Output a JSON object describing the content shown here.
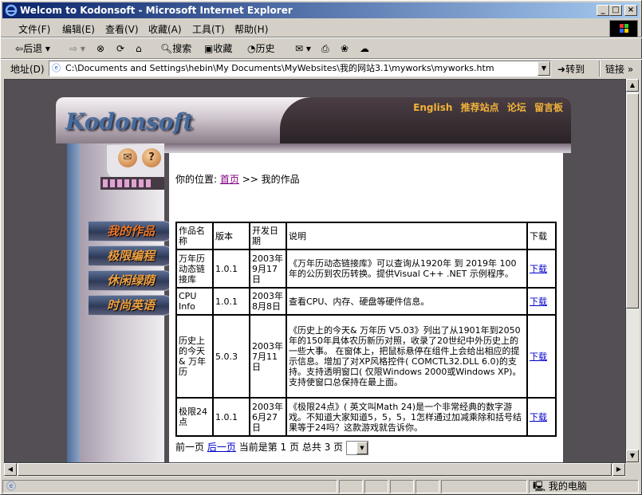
{
  "window": {
    "title": "Welcom to Kodonsoft - Microsoft Internet Explorer",
    "min": "_",
    "max": "□",
    "close": "×"
  },
  "menu": {
    "file": "文件(F)",
    "edit": "编辑(E)",
    "view": "查看(V)",
    "favorites": "收藏(A)",
    "tools": "工具(T)",
    "help": "帮助(H)"
  },
  "toolbar": {
    "back": "后退",
    "search": "搜索",
    "favorites": "收藏",
    "history": "历史"
  },
  "address": {
    "label": "地址(D)",
    "url": "C:\\Documents and Settings\\hebin\\My Documents\\MyWebsites\\我的网站3.1\\myworks\\myworks.htm",
    "go": "转到",
    "links": "链接"
  },
  "site": {
    "logo": "Kodonsoft",
    "toplinks": [
      "English",
      "推荐站点",
      "论坛",
      "留言板"
    ],
    "nav": [
      "我的作品",
      "极限编程",
      "休闲绿荫",
      "时尚英语"
    ]
  },
  "breadcrumb": {
    "prefix": "你的位置:",
    "home": "首页",
    "sep": ">>",
    "current": "我的作品"
  },
  "table": {
    "headers": [
      "作品名称",
      "版本",
      "开发日期",
      "说明",
      "下载"
    ],
    "rows": [
      {
        "name": "万年历动态链接库",
        "version": "1.0.1",
        "date": "2003年9月17日",
        "desc": "《万年历动态链接库》可以查询从1920年 到 2019年 100 年的公历到农历转换。提供Visual C++ .NET 示例程序。",
        "download": "下载"
      },
      {
        "name": "CPU Info",
        "version": "1.0.1",
        "date": "2003年8月8日",
        "desc": "查看CPU、内存、硬盘等硬件信息。",
        "download": "下载"
      },
      {
        "name": "历史上的今天& 万年历",
        "version": "5.0.3",
        "date": "2003年7月11日",
        "desc": "《历史上的今天& 万年历 V5.03》列出了从1901年到2050年的150年具体农历新历对照，收录了20世纪中外历史上的一些大事。 在窗体上，把鼠标悬停在组件上会给出相应的提示信息。增加了对XP风格控件( COMCTL32.DLL 6.0)的支持。支持透明窗口( 仅限Windows 2000或Windows XP)。支持使窗口总保持在最上面。",
        "download": "下载"
      },
      {
        "name": "极限24点",
        "version": "1.0.1",
        "date": "2003年6月27日",
        "desc": "《极限24点》( 英文叫Math 24)是一个非常经典的数字游戏。不知道大家知道5，5，5，1怎样通过加减乘除和括号结果等于24吗？这款游戏就告诉你。",
        "download": "下载"
      }
    ]
  },
  "pager": {
    "first": "前一页",
    "next": "后一页",
    "current_prefix": "当前是第",
    "current_page": "1",
    "page_word": "页",
    "total_prefix": "总共",
    "total_pages": "3",
    "page_word2": "页"
  },
  "status": {
    "zone": "我的电脑"
  }
}
